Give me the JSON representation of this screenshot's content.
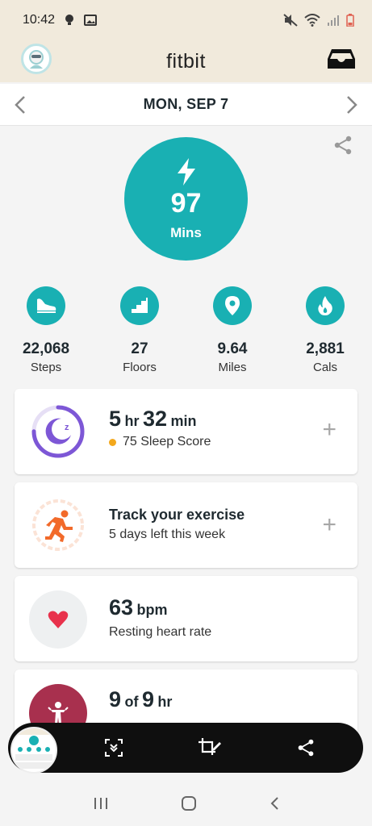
{
  "status_bar": {
    "time": "10:42"
  },
  "header": {
    "title": "fitbit"
  },
  "date_bar": {
    "date": "MON, SEP 7"
  },
  "active_minutes": {
    "value": "97",
    "unit": "Mins"
  },
  "stats": [
    {
      "icon": "shoe-icon",
      "value": "22,068",
      "label": "Steps"
    },
    {
      "icon": "stairs-icon",
      "value": "27",
      "label": "Floors"
    },
    {
      "icon": "map-pin-icon",
      "value": "9.64",
      "label": "Miles"
    },
    {
      "icon": "flame-icon",
      "value": "2,881",
      "label": "Cals"
    }
  ],
  "sleep_card": {
    "hours": "5",
    "hr_unit": "hr",
    "minutes": "32",
    "min_unit": "min",
    "score": "75 Sleep Score",
    "score_color": "#f3a81d",
    "progress": 0.75
  },
  "exercise_card": {
    "title": "Track your exercise",
    "subtitle": "5 days left this week"
  },
  "heart_card": {
    "value": "63",
    "unit": "bpm",
    "subtitle": "Resting heart rate"
  },
  "hourly_card": {
    "value": "9",
    "of": "of",
    "total": "9",
    "unit": "hr"
  },
  "colors": {
    "accent": "#19b0b3",
    "header_bg": "#f1eadc",
    "sleep": "#7d57d6",
    "exercise": "#f26a2a",
    "heart": "#e8324c",
    "hourly": "#a8304e"
  }
}
